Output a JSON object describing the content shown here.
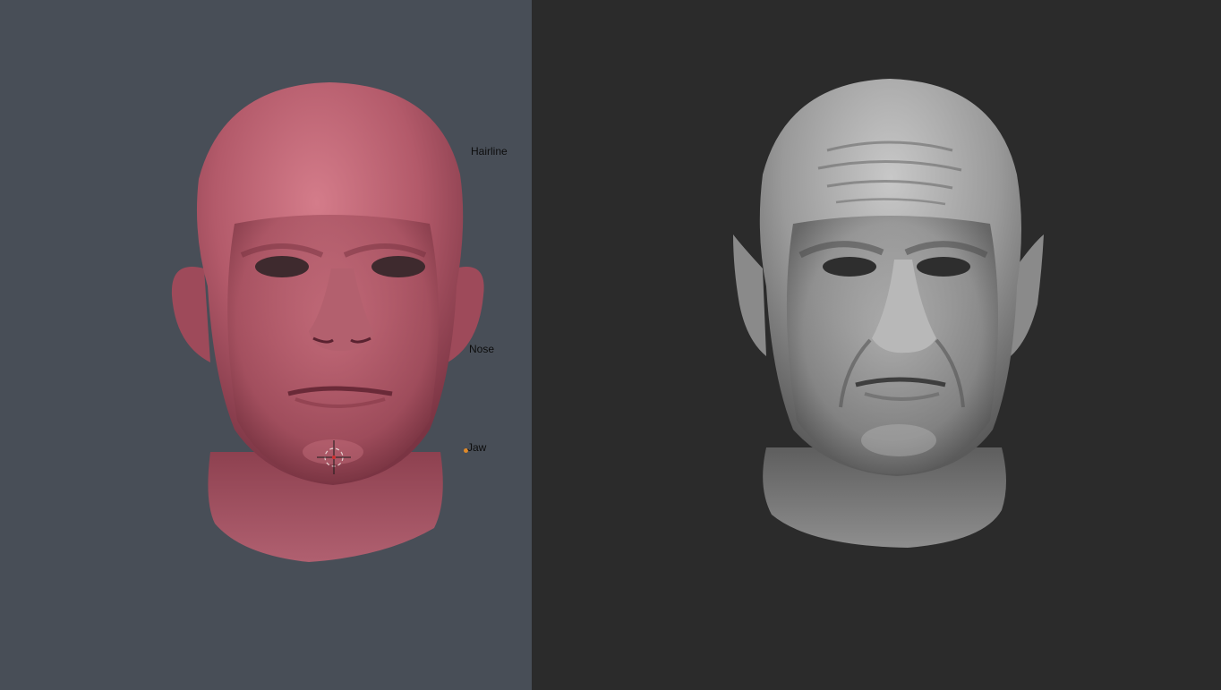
{
  "viewport_left": {
    "background": "#484e57",
    "model_color": "#b35a6a",
    "markers": [
      {
        "label": "Hairline"
      },
      {
        "label": "Nose"
      },
      {
        "label": "Jaw"
      }
    ],
    "marker_dot_color": "#e08a2a",
    "cursor": "brush-cursor-icon"
  },
  "viewport_right": {
    "background": "#2b2b2b",
    "model_color": "#a8a8a8"
  }
}
